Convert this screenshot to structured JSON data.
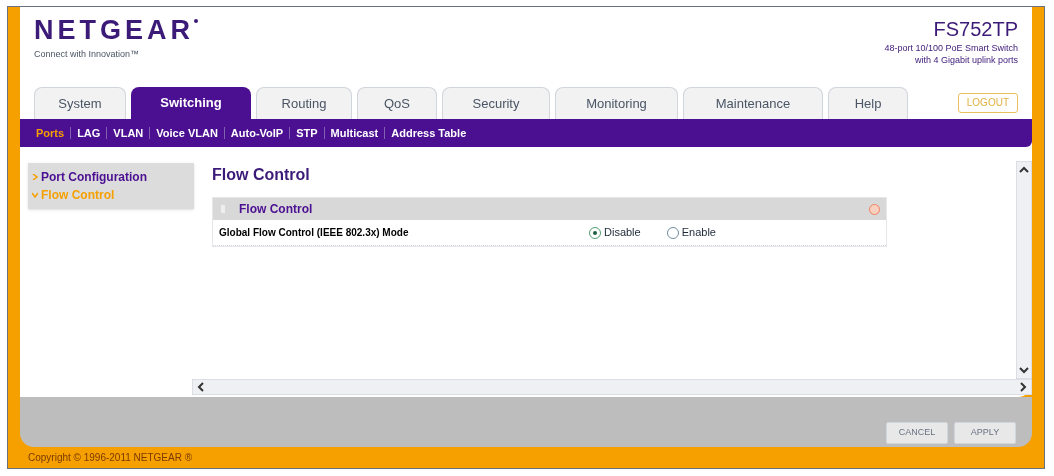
{
  "header": {
    "brand": "NETGEAR",
    "tagline": "Connect with Innovation™",
    "model": "FS752TP",
    "description_lines": [
      "48-port 10/100 PoE Smart Switch",
      "with 4 Gigabit uplink ports"
    ],
    "logout": "LOGOUT"
  },
  "tabs": [
    {
      "label": "System",
      "selected": false
    },
    {
      "label": "Switching",
      "selected": true
    },
    {
      "label": "Routing",
      "selected": false
    },
    {
      "label": "QoS",
      "selected": false
    },
    {
      "label": "Security",
      "selected": false
    },
    {
      "label": "Monitoring",
      "selected": false
    },
    {
      "label": "Maintenance",
      "selected": false
    },
    {
      "label": "Help",
      "selected": false
    }
  ],
  "subnav": [
    {
      "label": "Ports",
      "selected": true
    },
    {
      "label": "LAG",
      "selected": false
    },
    {
      "label": "VLAN",
      "selected": false
    },
    {
      "label": "Voice VLAN",
      "selected": false
    },
    {
      "label": "Auto-VoIP",
      "selected": false
    },
    {
      "label": "STP",
      "selected": false
    },
    {
      "label": "Multicast",
      "selected": false
    },
    {
      "label": "Address Table",
      "selected": false
    }
  ],
  "sidebar": {
    "items": [
      {
        "label": "Port Configuration",
        "selected": false
      },
      {
        "label": "Flow Control",
        "selected": true
      }
    ]
  },
  "page_title": "Flow Control",
  "panel": {
    "title": "Flow Control",
    "rows": [
      {
        "label": "Global Flow Control (IEEE 802.3x) Mode",
        "options": [
          {
            "label": "Disable",
            "selected": true
          },
          {
            "label": "Enable",
            "selected": false
          }
        ]
      }
    ]
  },
  "buttons": [
    "CANCEL",
    "APPLY"
  ],
  "footer": "Copyright © 1996-2011 NETGEAR ®"
}
